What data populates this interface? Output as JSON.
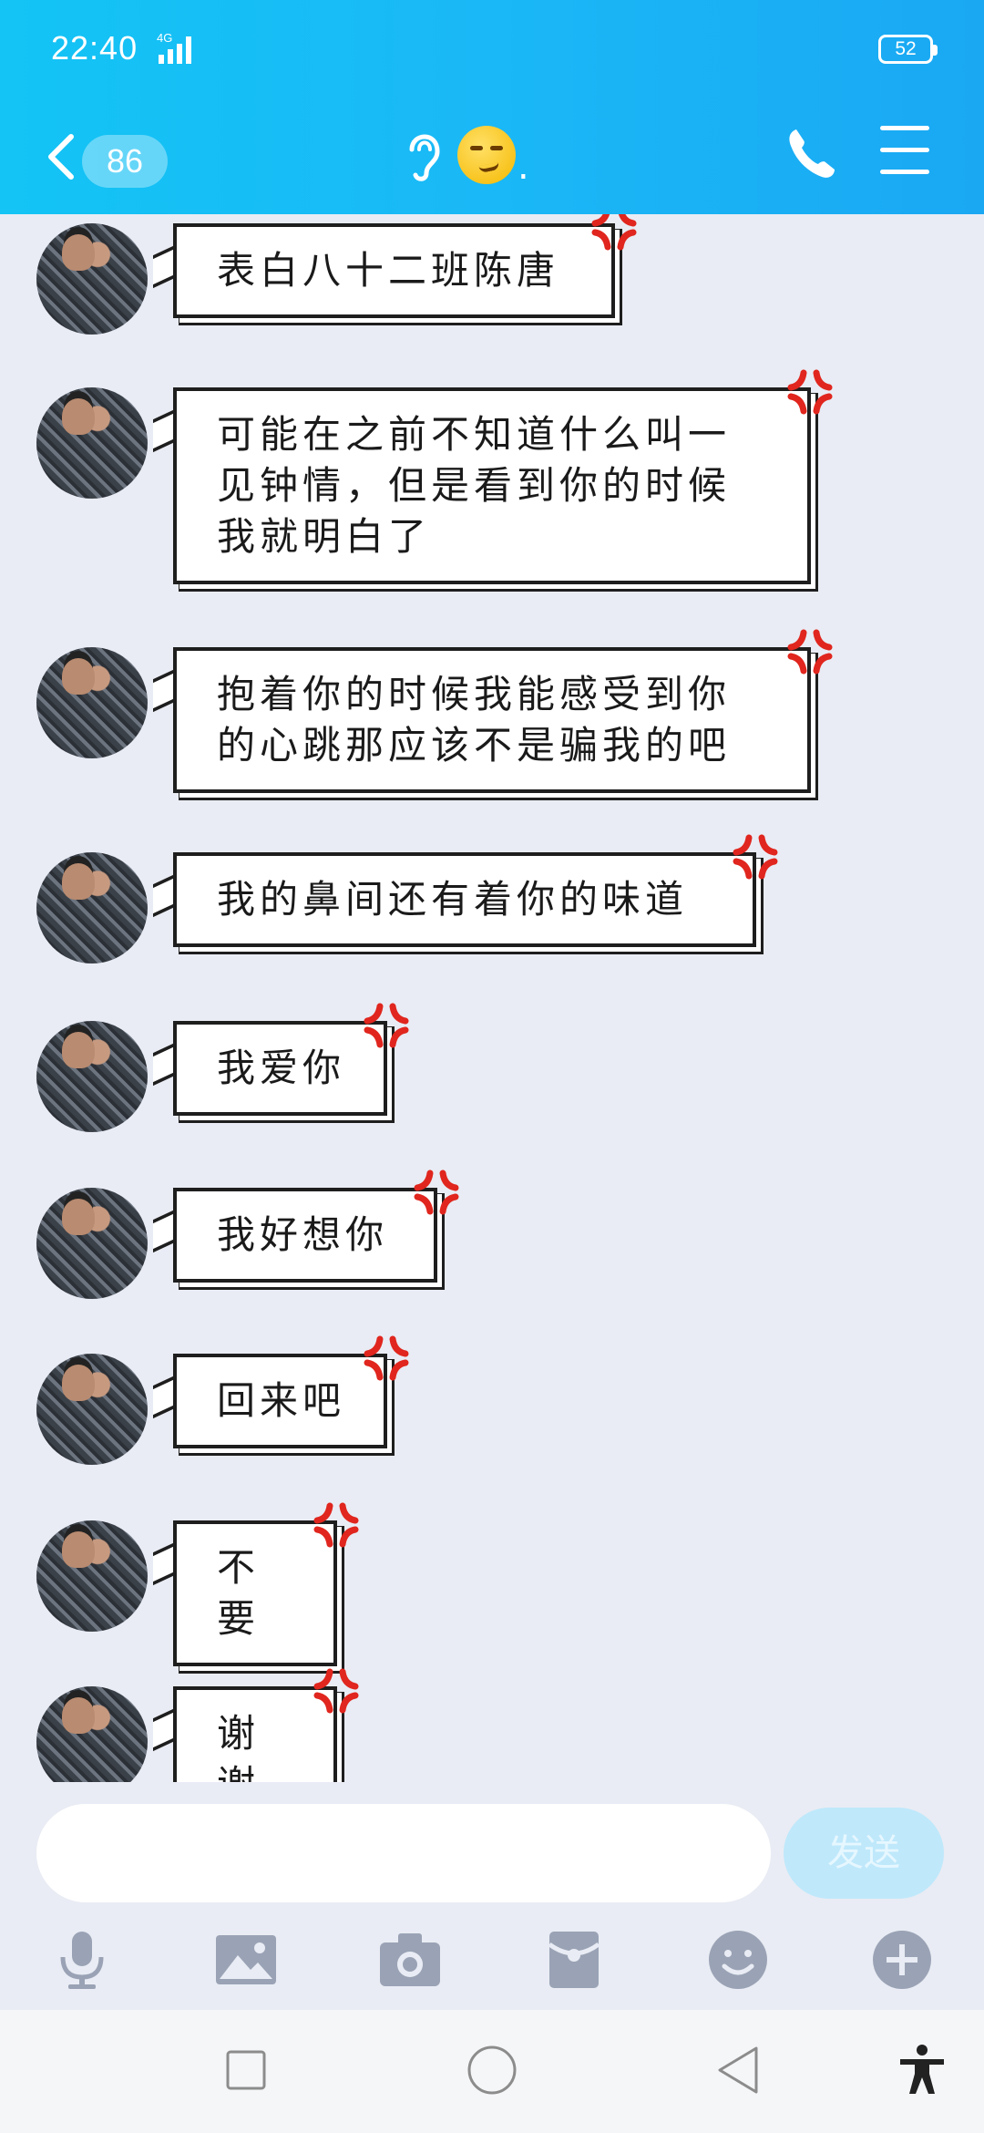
{
  "status_bar": {
    "time": "22:40",
    "network": "4G",
    "battery": "52"
  },
  "nav": {
    "unread_count": "86",
    "title_suffix": "."
  },
  "messages": [
    {
      "text": "表白八十二班陈唐"
    },
    {
      "text": "可能在之前不知道什么叫一见钟情，但是看到你的时候我就明白了"
    },
    {
      "text": "抱着你的时候我能感受到你的心跳那应该不是骗我的吧"
    },
    {
      "text": "我的鼻间还有着你的味道"
    },
    {
      "text": "我爱你"
    },
    {
      "text": "我好想你"
    },
    {
      "text": "回来吧"
    },
    {
      "text": "不要"
    },
    {
      "text": "谢谢"
    }
  ],
  "input": {
    "value": "",
    "send_label": "发送"
  },
  "toolbar_icons": [
    "microphone-icon",
    "image-icon",
    "camera-icon",
    "red-packet-icon",
    "emoji-icon",
    "plus-icon"
  ],
  "colors": {
    "header_start": "#13c4f5",
    "header_end": "#1aa8f3",
    "chat_bg": "#e9ecf4",
    "icon_gray": "#9aa3b5",
    "anger_red": "#e0261e"
  }
}
